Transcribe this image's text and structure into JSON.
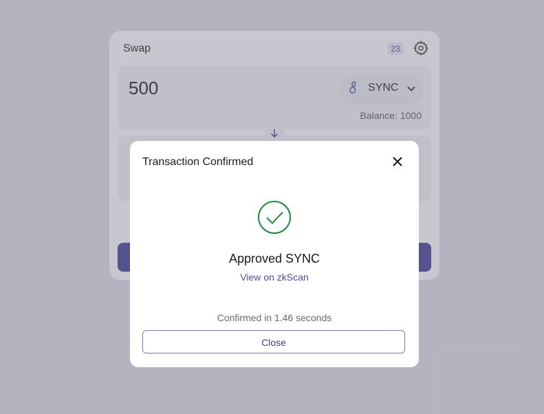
{
  "swap": {
    "title": "Swap",
    "slippage_badge": "23",
    "amount": "500",
    "token": "SYNC",
    "balance": "Balance: 1000"
  },
  "modal": {
    "title": "Transaction Confirmed",
    "status": "Approved SYNC",
    "explorer_link": "View on zkScan",
    "confirmed_text": "Confirmed in 1.46 seconds",
    "close_label": "Close"
  },
  "colors": {
    "accent": "#3d3d8f",
    "success": "#1a8a3c"
  },
  "icons": {
    "settings": "gear-icon",
    "token": "sync-token-icon",
    "swap_direction": "arrow-down-icon",
    "close": "close-icon",
    "success": "check-circle-icon"
  }
}
